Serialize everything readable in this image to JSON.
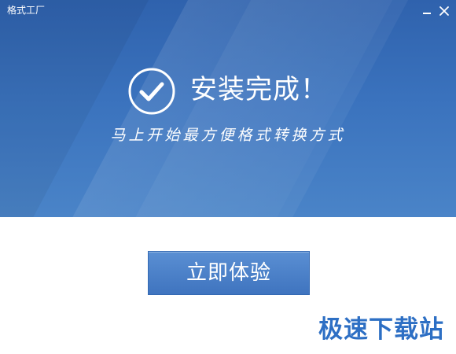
{
  "window": {
    "title": "格式工厂",
    "minimize_icon": "minimize-icon",
    "close_icon": "close-icon"
  },
  "banner": {
    "icon": "check-circle-icon",
    "heading": "安装完成！",
    "subtitle": "马上开始最方便格式转换方式"
  },
  "action": {
    "button_label": "立即体验"
  },
  "watermark": {
    "text": "极速下载站"
  },
  "colors": {
    "banner_blue": "#3a72bd",
    "button_blue": "#4a80c8",
    "watermark_blue": "#2d6fc4",
    "background": "#ffffff"
  }
}
